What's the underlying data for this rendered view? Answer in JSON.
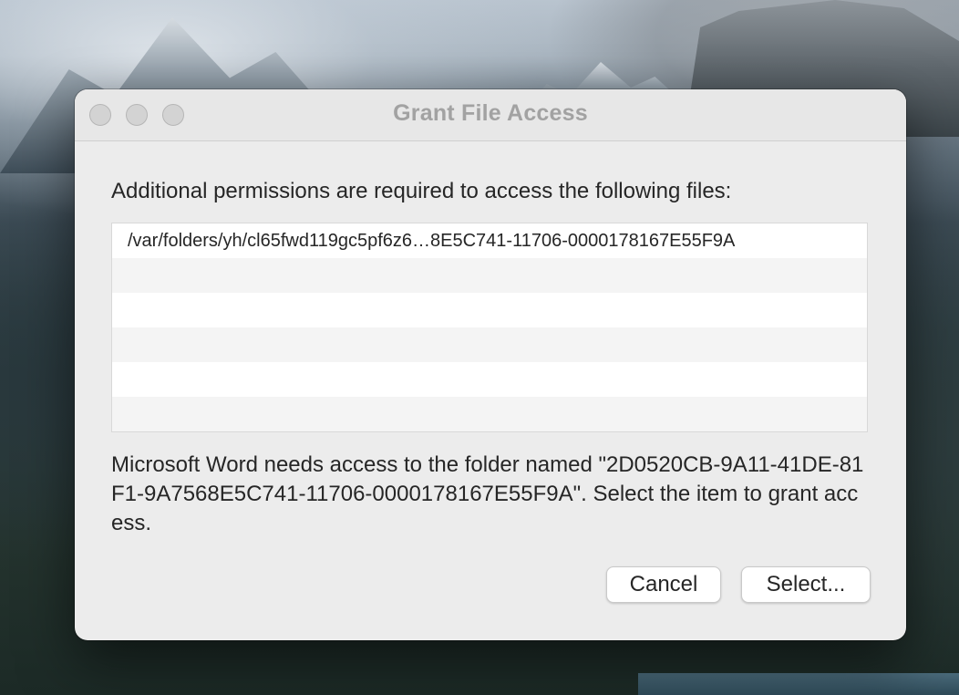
{
  "window": {
    "title": "Grant File Access"
  },
  "dialog": {
    "prompt": "Additional permissions are required to access the following files:",
    "files": [
      "/var/folders/yh/cl65fwd119gc5pf6z6…8E5C741-11706-0000178167E55F9A",
      "",
      "",
      "",
      "",
      ""
    ],
    "message": "Microsoft Word needs access to the folder named \"2D0520CB-9A11-41DE-81F1-9A7568E5C741-11706-0000178167E55F9A\". Select the item to grant access.",
    "cancel_label": "Cancel",
    "select_label": "Select..."
  },
  "colors": {
    "window_bg": "#ececec",
    "title_text": "#a2a2a2",
    "body_text": "#262626",
    "traffic_inactive": "#d3d3d3"
  }
}
